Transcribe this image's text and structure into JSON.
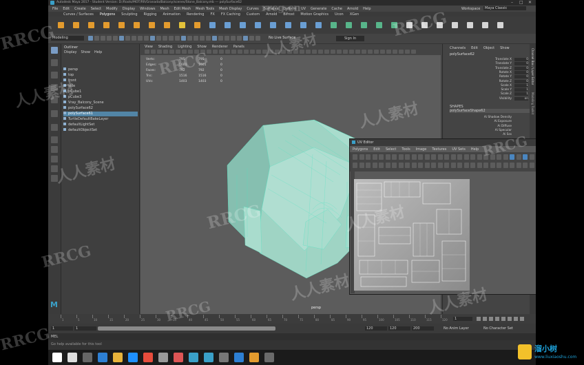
{
  "app": {
    "title": "Autodesk Maya 2017 - Student Version: D:/Roots/MOT/RR/Granada/Balcony/scenes/Stone_Balcony.mb  ---  polySurface62",
    "workspace_label": "Workspace",
    "workspace_value": "Maya Classic"
  },
  "menus": [
    "File",
    "Edit",
    "Create",
    "Select",
    "Modify",
    "Display",
    "Windows",
    "Mesh",
    "Edit Mesh",
    "Mesh Tools",
    "Mesh Display",
    "Curves",
    "Surfaces",
    "Deform",
    "UV",
    "Generate",
    "Cache",
    "Arnold",
    "Help"
  ],
  "shelf_tabs": [
    "Curves / Surfaces",
    "Polygons",
    "Sculpting",
    "Rigging",
    "Animation",
    "Rendering",
    "FX",
    "FX Caching",
    "Custom",
    "Arnold",
    "Bifrost",
    "Motion Graphics",
    "Ucon",
    "XGen"
  ],
  "status_line": {
    "mode": "Modeling",
    "live_surface": "No Live Surface",
    "sign_in": "Sign In"
  },
  "outliner": {
    "title": "Outliner",
    "menu": [
      "Display",
      "Show",
      "Help"
    ],
    "items": [
      "persp",
      "top",
      "front",
      "side",
      "pCube1",
      "pCube3",
      "Vray_Balcony_Scene",
      "polySurface62",
      "polySurface61",
      "TurtleDefaultBakeLayer",
      "defaultLightSet",
      "defaultObjectSet"
    ],
    "selected_index": 8
  },
  "viewport": {
    "menu": [
      "View",
      "Shading",
      "Lighting",
      "Show",
      "Renderer",
      "Panels"
    ],
    "hud": [
      {
        "label": "Verts:",
        "a": "795",
        "b": "795",
        "c": "0"
      },
      {
        "label": "Edges:",
        "a": "1601",
        "b": "1601",
        "c": "0"
      },
      {
        "label": "Faces:",
        "a": "792",
        "b": "792",
        "c": "0"
      },
      {
        "label": "Tris:",
        "a": "1516",
        "b": "1516",
        "c": "0"
      },
      {
        "label": "UVs:",
        "a": "1403",
        "b": "1403",
        "c": "0"
      }
    ],
    "camera": "persp"
  },
  "channel_box": {
    "menu": [
      "Channels",
      "Edit",
      "Object",
      "Show"
    ],
    "object": "polySurface62",
    "attributes": [
      {
        "name": "Translate X",
        "value": "0"
      },
      {
        "name": "Translate Y",
        "value": "0"
      },
      {
        "name": "Translate Z",
        "value": "0"
      },
      {
        "name": "Rotate X",
        "value": "0"
      },
      {
        "name": "Rotate Y",
        "value": "0"
      },
      {
        "name": "Rotate Z",
        "value": "0"
      },
      {
        "name": "Scale X",
        "value": "1"
      },
      {
        "name": "Scale Y",
        "value": "1"
      },
      {
        "name": "Scale Z",
        "value": "1"
      },
      {
        "name": "Visibility",
        "value": "on"
      }
    ],
    "shapes_label": "SHAPES",
    "shape_name": "polySurfaceShape62",
    "shape_attrs": [
      "Ai Shadow Density",
      "Ai Exposure",
      "Ai Diffuse",
      "Ai Specular",
      "Ai Sss"
    ],
    "side_tabs": [
      "Channel Box / Layer Editor",
      "Modeling Toolkit"
    ]
  },
  "uv_editor": {
    "title": "UV Editor",
    "menu": [
      "Polygons",
      "Edit",
      "Select",
      "Tools",
      "Image",
      "Textures",
      "UV Sets",
      "Help"
    ]
  },
  "timeline": {
    "ticks": [
      "1",
      "5",
      "10",
      "15",
      "20",
      "25",
      "30",
      "35",
      "40",
      "45",
      "50",
      "55",
      "60",
      "65",
      "70",
      "75",
      "80",
      "85",
      "90",
      "95",
      "100",
      "105",
      "110",
      "115",
      "120"
    ],
    "current_frame": "1",
    "range_start": "1",
    "range_start_inner": "1",
    "range_end_inner": "120",
    "range_end": "120",
    "range_end_max": "200",
    "anim_layer": "No Anim Layer",
    "char_set": "No Character Set"
  },
  "command_line": {
    "lang": "MEL"
  },
  "help_line": "Go help available for this tool",
  "watermarks": [
    "RRCG",
    "人人素材",
    "rrcg.cn"
  ],
  "badge": {
    "text": "溜小树",
    "url": "www.liuxiaoshu.com"
  },
  "colors": {
    "accent": "#2a6fb0",
    "mesh": "#9fd4c4",
    "wire": "#49e3c0",
    "maya_logo": "#3aa0c8"
  }
}
